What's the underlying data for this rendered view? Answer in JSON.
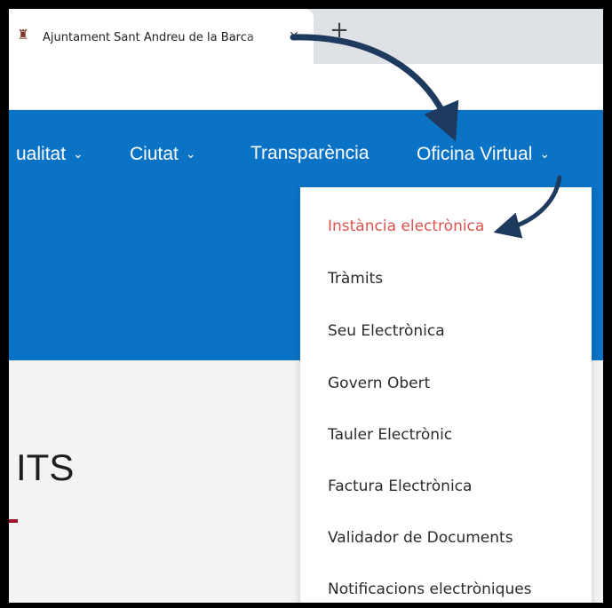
{
  "browser": {
    "tab_title": "Ajuntament Sant Andreu de la Barca",
    "favicon": "crest-icon",
    "close_glyph": "✕",
    "new_tab_glyph": "+"
  },
  "nav": {
    "items": [
      {
        "label": "ualitat",
        "icon": "chevron-down-icon"
      },
      {
        "label": "Ciutat",
        "icon": "chevron-down-icon"
      },
      {
        "label": "Transparència"
      },
      {
        "label": "Oficina Virtual",
        "icon": "chevron-down-icon"
      }
    ],
    "chevron_glyph": "⌄"
  },
  "dropdown": {
    "items": [
      {
        "label": "Instància electrònica",
        "active": true
      },
      {
        "label": "Tràmits"
      },
      {
        "label": "Seu Electrònica"
      },
      {
        "label": "Govern Obert"
      },
      {
        "label": "Tauler Electrònic"
      },
      {
        "label": "Factura Electrònica"
      },
      {
        "label": "Validador de Documents"
      },
      {
        "label": "Notificacions electròniques"
      }
    ]
  },
  "page": {
    "heading_fragment": "ITS"
  },
  "colors": {
    "nav_blue": "#0a73c6",
    "active_item": "#d9534f",
    "arrow": "#1f3a5f",
    "underline_accent": "#a0102a"
  }
}
